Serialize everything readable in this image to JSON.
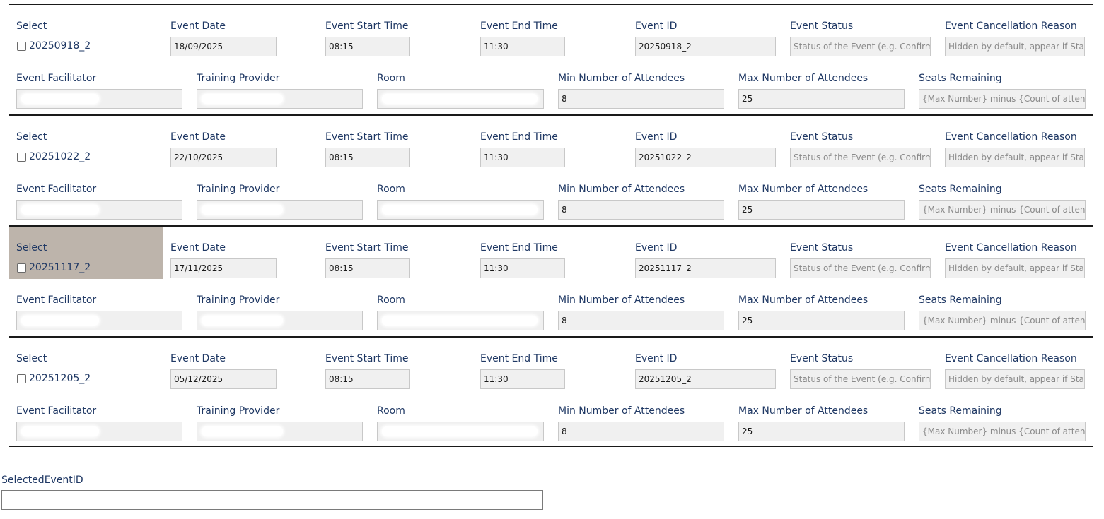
{
  "labels": {
    "select": "Select",
    "event_date": "Event Date",
    "event_start_time": "Event Start Time",
    "event_end_time": "Event End Time",
    "event_id": "Event ID",
    "event_status": "Event Status",
    "event_cancellation_reason": "Event Cancellation Reason",
    "event_facilitator": "Event Facilitator",
    "training_provider": "Training Provider",
    "room": "Room",
    "min_attendees": "Min Number of Attendees",
    "max_attendees": "Max Number of Attendees",
    "seats_remaining": "Seats Remaining"
  },
  "placeholders": {
    "event_status": "Status of the Event (e.g. Confirm",
    "event_cancellation_reason": "Hidden by default, appear if Sta",
    "seats_remaining": "{Max Number} minus {Count of atten"
  },
  "events": [
    {
      "select_label": "20250918_2",
      "checked": false,
      "highlighted": false,
      "event_date": "18/09/2025",
      "start_time": "08:15",
      "end_time": "11:30",
      "event_id": "20250918_2",
      "min_attendees": "8",
      "max_attendees": "25"
    },
    {
      "select_label": "20251022_2",
      "checked": false,
      "highlighted": false,
      "event_date": "22/10/2025",
      "start_time": "08:15",
      "end_time": "11:30",
      "event_id": "20251022_2",
      "min_attendees": "8",
      "max_attendees": "25"
    },
    {
      "select_label": "20251117_2",
      "checked": false,
      "highlighted": true,
      "event_date": "17/11/2025",
      "start_time": "08:15",
      "end_time": "11:30",
      "event_id": "20251117_2",
      "min_attendees": "8",
      "max_attendees": "25"
    },
    {
      "select_label": "20251205_2",
      "checked": false,
      "highlighted": false,
      "event_date": "05/12/2025",
      "start_time": "08:15",
      "end_time": "11:30",
      "event_id": "20251205_2",
      "min_attendees": "8",
      "max_attendees": "25"
    }
  ],
  "selected_event": {
    "label": "SelectedEventID",
    "value": ""
  },
  "colors": {
    "label_text": "#1f3864",
    "field_bg": "#f0f0f0",
    "highlight_bg": "#bdb4ab",
    "divider": "#1a1a1a"
  }
}
